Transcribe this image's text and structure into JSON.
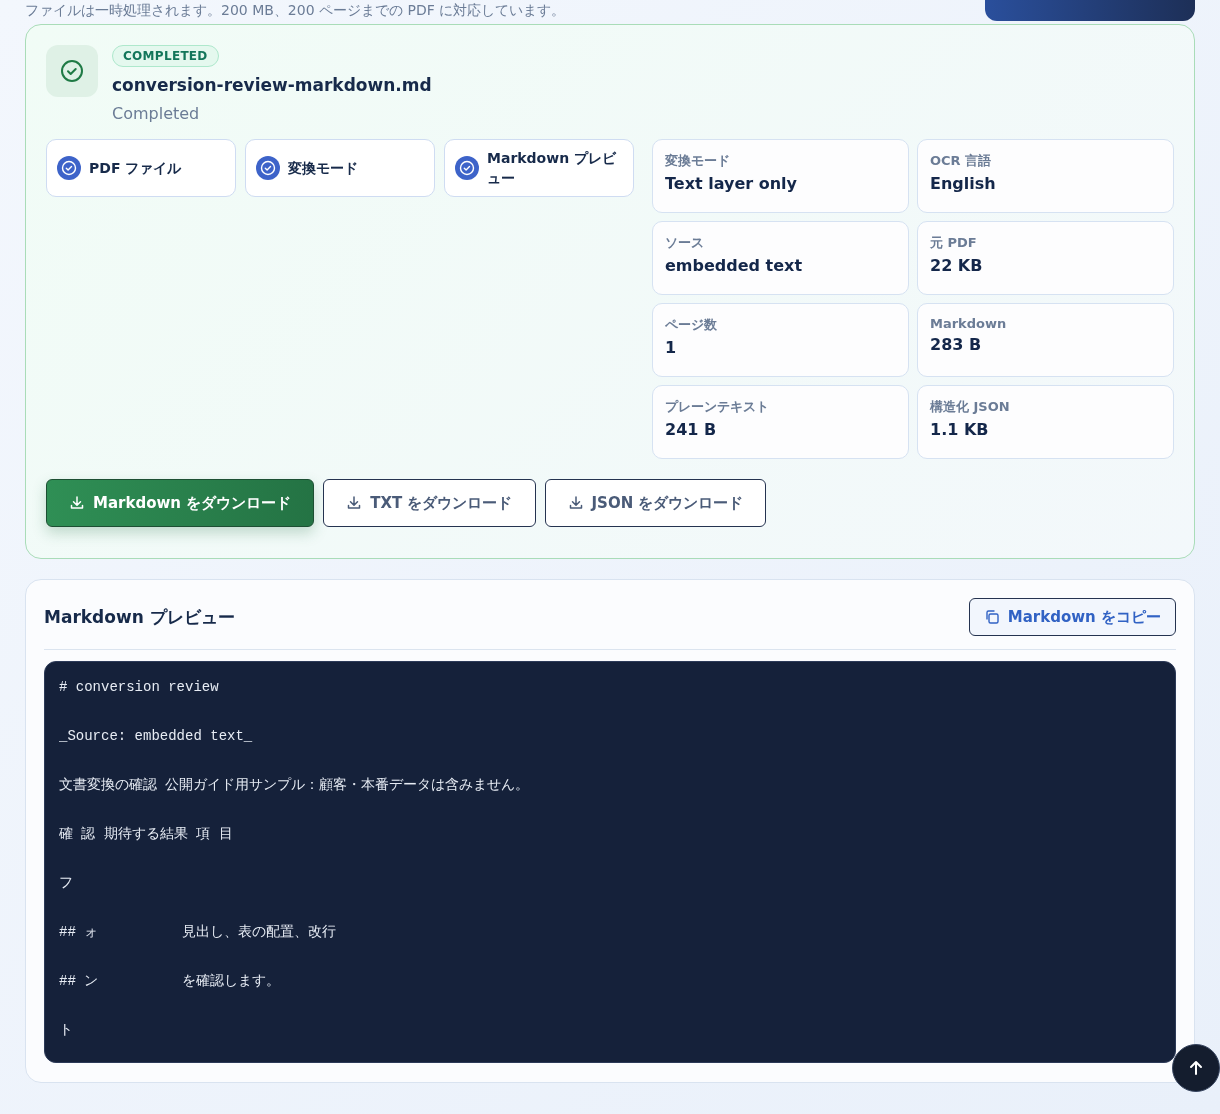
{
  "intro_note": "ファイルは一時処理されます。200 MB、200 ページまでの PDF に対応しています。",
  "result": {
    "badge": "COMPLETED",
    "filename": "conversion-review-markdown.md",
    "status": "Completed",
    "steps": [
      {
        "label": "PDF ファイル",
        "done": true
      },
      {
        "label": "変換モード",
        "done": true
      },
      {
        "label": "Markdown プレビュー",
        "done": true
      }
    ],
    "stats": [
      {
        "label": "変換モード",
        "value": "Text layer only"
      },
      {
        "label": "OCR 言語",
        "value": "English"
      },
      {
        "label": "ソース",
        "value": "embedded text"
      },
      {
        "label": "元 PDF",
        "value": "22 KB"
      },
      {
        "label": "ページ数",
        "value": "1"
      },
      {
        "label": "Markdown",
        "value": "283 B"
      },
      {
        "label": "プレーンテキスト",
        "value": "241 B"
      },
      {
        "label": "構造化 JSON",
        "value": "1.1 KB"
      }
    ],
    "downloads": [
      {
        "label": "Markdown をダウンロード",
        "primary": true
      },
      {
        "label": "TXT をダウンロード",
        "primary": false
      },
      {
        "label": "JSON をダウンロード",
        "primary": false
      }
    ]
  },
  "preview": {
    "title": "Markdown プレビュー",
    "copy_button": "Markdown をコピー",
    "lines": [
      "# conversion review",
      "_Source: embedded text_",
      "文書変換の確認 公開ガイド用サンプル：顧客・本番データは含みません。",
      "確 認 期待する結果 項 目",
      "フ",
      "## ォ          見出し、表の配置、改行",
      "## ン          を確認します。",
      "ト"
    ]
  }
}
